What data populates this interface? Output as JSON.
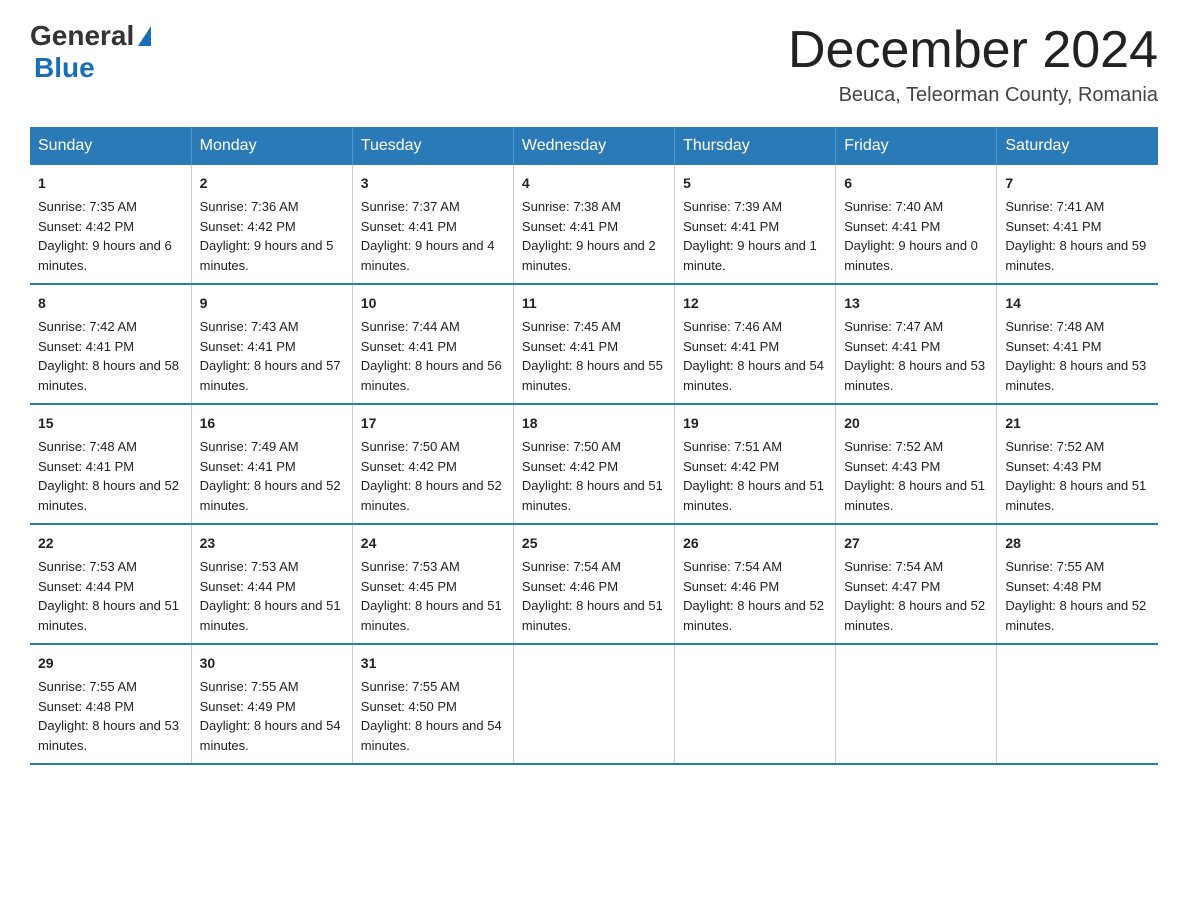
{
  "logo": {
    "general": "General",
    "blue": "Blue"
  },
  "header": {
    "title": "December 2024",
    "location": "Beuca, Teleorman County, Romania"
  },
  "days_of_week": [
    "Sunday",
    "Monday",
    "Tuesday",
    "Wednesday",
    "Thursday",
    "Friday",
    "Saturday"
  ],
  "weeks": [
    [
      {
        "day": "1",
        "sunrise": "7:35 AM",
        "sunset": "4:42 PM",
        "daylight": "9 hours and 6 minutes."
      },
      {
        "day": "2",
        "sunrise": "7:36 AM",
        "sunset": "4:42 PM",
        "daylight": "9 hours and 5 minutes."
      },
      {
        "day": "3",
        "sunrise": "7:37 AM",
        "sunset": "4:41 PM",
        "daylight": "9 hours and 4 minutes."
      },
      {
        "day": "4",
        "sunrise": "7:38 AM",
        "sunset": "4:41 PM",
        "daylight": "9 hours and 2 minutes."
      },
      {
        "day": "5",
        "sunrise": "7:39 AM",
        "sunset": "4:41 PM",
        "daylight": "9 hours and 1 minute."
      },
      {
        "day": "6",
        "sunrise": "7:40 AM",
        "sunset": "4:41 PM",
        "daylight": "9 hours and 0 minutes."
      },
      {
        "day": "7",
        "sunrise": "7:41 AM",
        "sunset": "4:41 PM",
        "daylight": "8 hours and 59 minutes."
      }
    ],
    [
      {
        "day": "8",
        "sunrise": "7:42 AM",
        "sunset": "4:41 PM",
        "daylight": "8 hours and 58 minutes."
      },
      {
        "day": "9",
        "sunrise": "7:43 AM",
        "sunset": "4:41 PM",
        "daylight": "8 hours and 57 minutes."
      },
      {
        "day": "10",
        "sunrise": "7:44 AM",
        "sunset": "4:41 PM",
        "daylight": "8 hours and 56 minutes."
      },
      {
        "day": "11",
        "sunrise": "7:45 AM",
        "sunset": "4:41 PM",
        "daylight": "8 hours and 55 minutes."
      },
      {
        "day": "12",
        "sunrise": "7:46 AM",
        "sunset": "4:41 PM",
        "daylight": "8 hours and 54 minutes."
      },
      {
        "day": "13",
        "sunrise": "7:47 AM",
        "sunset": "4:41 PM",
        "daylight": "8 hours and 53 minutes."
      },
      {
        "day": "14",
        "sunrise": "7:48 AM",
        "sunset": "4:41 PM",
        "daylight": "8 hours and 53 minutes."
      }
    ],
    [
      {
        "day": "15",
        "sunrise": "7:48 AM",
        "sunset": "4:41 PM",
        "daylight": "8 hours and 52 minutes."
      },
      {
        "day": "16",
        "sunrise": "7:49 AM",
        "sunset": "4:41 PM",
        "daylight": "8 hours and 52 minutes."
      },
      {
        "day": "17",
        "sunrise": "7:50 AM",
        "sunset": "4:42 PM",
        "daylight": "8 hours and 52 minutes."
      },
      {
        "day": "18",
        "sunrise": "7:50 AM",
        "sunset": "4:42 PM",
        "daylight": "8 hours and 51 minutes."
      },
      {
        "day": "19",
        "sunrise": "7:51 AM",
        "sunset": "4:42 PM",
        "daylight": "8 hours and 51 minutes."
      },
      {
        "day": "20",
        "sunrise": "7:52 AM",
        "sunset": "4:43 PM",
        "daylight": "8 hours and 51 minutes."
      },
      {
        "day": "21",
        "sunrise": "7:52 AM",
        "sunset": "4:43 PM",
        "daylight": "8 hours and 51 minutes."
      }
    ],
    [
      {
        "day": "22",
        "sunrise": "7:53 AM",
        "sunset": "4:44 PM",
        "daylight": "8 hours and 51 minutes."
      },
      {
        "day": "23",
        "sunrise": "7:53 AM",
        "sunset": "4:44 PM",
        "daylight": "8 hours and 51 minutes."
      },
      {
        "day": "24",
        "sunrise": "7:53 AM",
        "sunset": "4:45 PM",
        "daylight": "8 hours and 51 minutes."
      },
      {
        "day": "25",
        "sunrise": "7:54 AM",
        "sunset": "4:46 PM",
        "daylight": "8 hours and 51 minutes."
      },
      {
        "day": "26",
        "sunrise": "7:54 AM",
        "sunset": "4:46 PM",
        "daylight": "8 hours and 52 minutes."
      },
      {
        "day": "27",
        "sunrise": "7:54 AM",
        "sunset": "4:47 PM",
        "daylight": "8 hours and 52 minutes."
      },
      {
        "day": "28",
        "sunrise": "7:55 AM",
        "sunset": "4:48 PM",
        "daylight": "8 hours and 52 minutes."
      }
    ],
    [
      {
        "day": "29",
        "sunrise": "7:55 AM",
        "sunset": "4:48 PM",
        "daylight": "8 hours and 53 minutes."
      },
      {
        "day": "30",
        "sunrise": "7:55 AM",
        "sunset": "4:49 PM",
        "daylight": "8 hours and 54 minutes."
      },
      {
        "day": "31",
        "sunrise": "7:55 AM",
        "sunset": "4:50 PM",
        "daylight": "8 hours and 54 minutes."
      },
      null,
      null,
      null,
      null
    ]
  ],
  "labels": {
    "sunrise": "Sunrise:",
    "sunset": "Sunset:",
    "daylight": "Daylight:"
  }
}
